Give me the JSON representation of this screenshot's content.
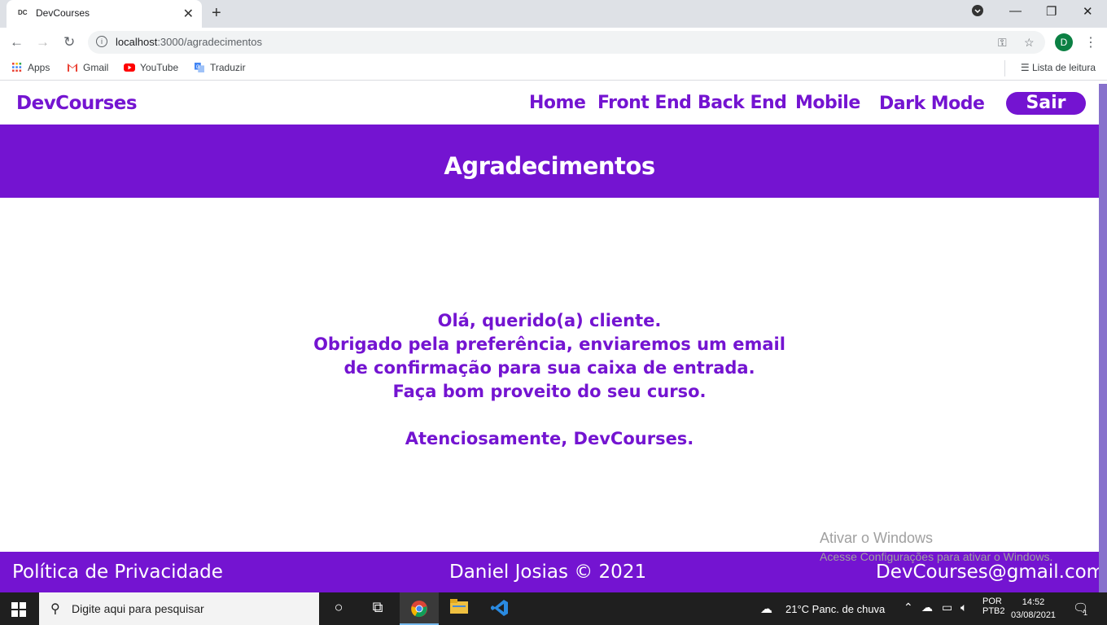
{
  "browser": {
    "tab_favicon": "DC",
    "tab_title": "DevCourses",
    "url_host": "localhost",
    "url_path": ":3000/agradecimentos",
    "profile_initial": "D",
    "bookmarks": [
      "Apps",
      "Gmail",
      "YouTube",
      "Traduzir"
    ],
    "reading_list": "Lista de leitura"
  },
  "site": {
    "brand": "DevCourses",
    "nav": [
      "Home",
      "Front End",
      "Back End",
      "Mobile",
      "Dark Mode"
    ],
    "logout": "Sair",
    "page_title": "Agradecimentos",
    "message_lines": [
      "Olá, querido(a) cliente.",
      "Obrigado pela preferência, enviaremos um email",
      "de confirmação para sua caixa de entrada.",
      "Faça bom proveito do seu curso."
    ],
    "signature": "Atenciosamente, DevCourses.",
    "footer": {
      "privacy": "Política de Privacidade",
      "copyright": "Daniel Josias © 2021",
      "email": "DevCourses@gmail.com"
    },
    "accent": "#7414d1"
  },
  "watermark": {
    "line1": "Ativar o Windows",
    "line2": "Acesse Configurações para ativar o Windows."
  },
  "taskbar": {
    "search_placeholder": "Digite aqui para pesquisar",
    "weather": "21°C  Panc. de chuva",
    "lang1": "POR",
    "lang2": "PTB2",
    "time": "14:52",
    "date": "03/08/2021",
    "notifications": "1"
  }
}
